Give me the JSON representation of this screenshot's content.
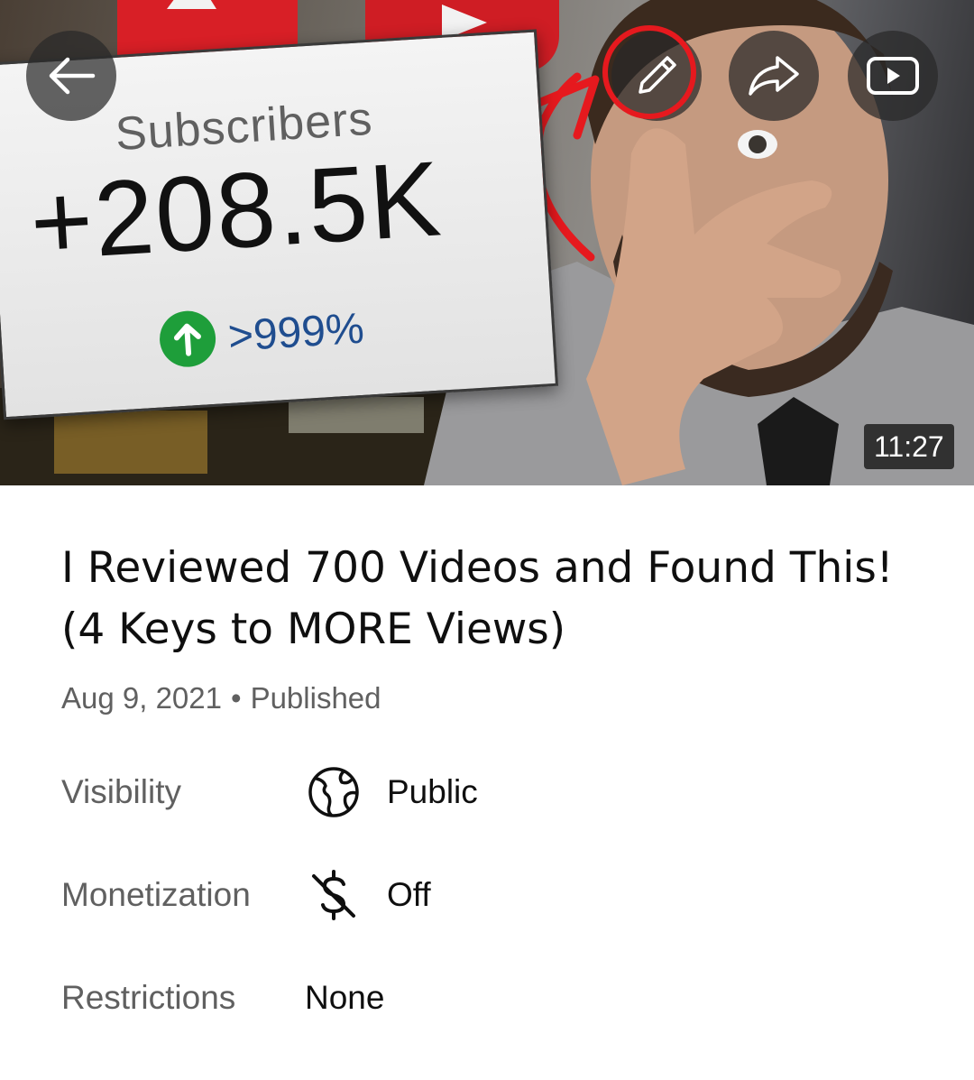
{
  "thumbnail": {
    "card_label": "Subscribers",
    "card_value": "+208.5K",
    "card_growth": ">999%",
    "duration": "11:27"
  },
  "toolbar": {
    "back_icon": "arrow-left-icon",
    "edit_icon": "pencil-icon",
    "share_icon": "share-arrow-icon",
    "youtube_icon": "youtube-play-icon",
    "highlight_color": "#e6191e"
  },
  "video": {
    "title": "I Reviewed 700 Videos and Found This! (4 Keys to MORE Views)",
    "date": "Aug 9, 2021",
    "separator": "•",
    "status": "Published"
  },
  "details": {
    "visibility": {
      "label": "Visibility",
      "icon": "globe-icon",
      "value": "Public"
    },
    "monetization": {
      "label": "Monetization",
      "icon": "no-money-icon",
      "value": "Off"
    },
    "restrictions": {
      "label": "Restrictions",
      "value": "None"
    }
  }
}
